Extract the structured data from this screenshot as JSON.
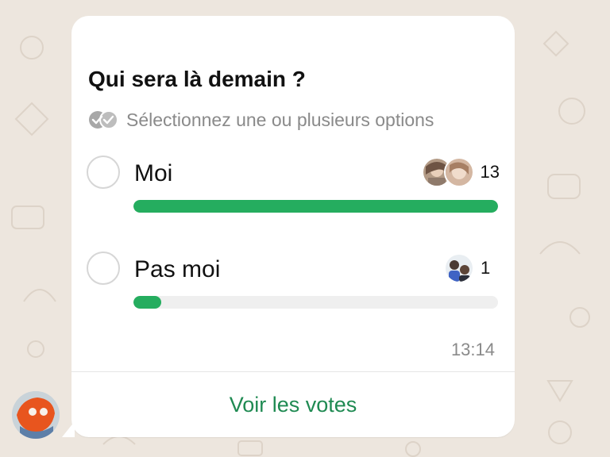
{
  "poll": {
    "question": "Qui sera là demain ?",
    "hint": "Sélectionnez une ou plusieurs options",
    "options": [
      {
        "label": "Moi",
        "votes": "13",
        "share": 1.0
      },
      {
        "label": "Pas moi",
        "votes": "1",
        "share": 0.077
      }
    ],
    "timestamp": "13:14",
    "view_votes_label": "Voir les votes"
  },
  "colors": {
    "bar_fill": "#25ad5f",
    "bar_track": "#efefef",
    "link": "#1f8a52",
    "wallpaper": "#ede6de"
  },
  "icons": [
    "double-check-icon",
    "radio-unchecked-icon",
    "avatar"
  ]
}
